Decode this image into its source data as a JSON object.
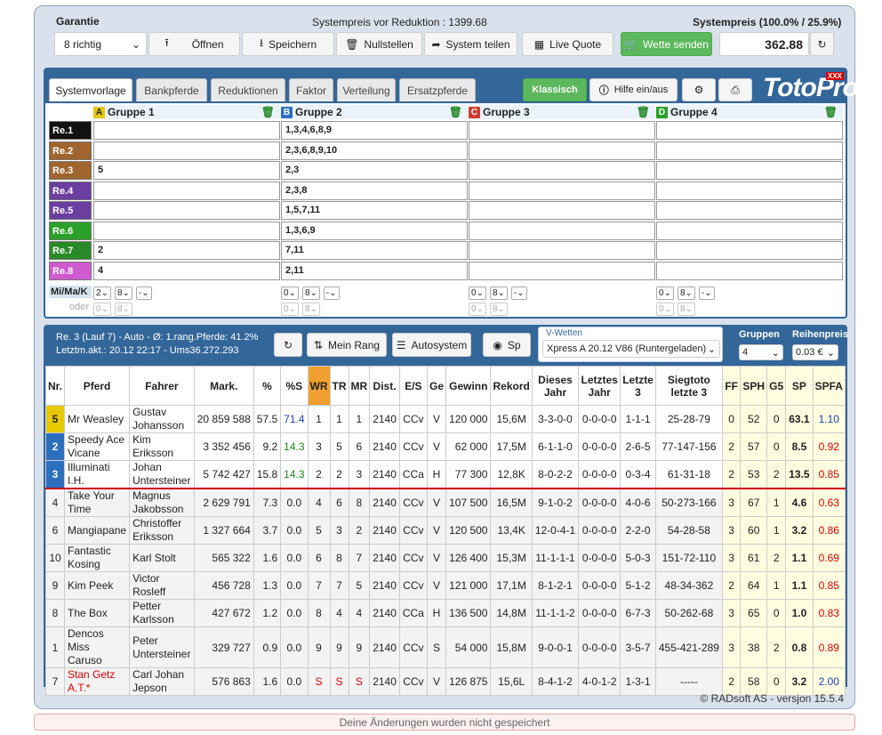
{
  "top": {
    "garantie": "Garantie",
    "richtig": "8 richtig",
    "systempreis_label": "Systempreis vor Reduktion : 1399.68",
    "systempreis_right": "Systempreis (100.0% / 25.9%)",
    "price": "362.88",
    "buttons": {
      "open": "Öffnen",
      "save": "Speichern",
      "reset": "Nullstellen",
      "share": "System teilen",
      "live": "Live Quote",
      "send": "Wette senden"
    }
  },
  "tabs": [
    "Systemvorlage",
    "Bankpferde",
    "Reduktionen",
    "Faktor",
    "Verteilung",
    "Ersatzpferde"
  ],
  "toolbar": {
    "klassisch": "Klassisch",
    "hilfe": "Hilfe ein/aus",
    "logo": "TotoPro",
    "logo_badge": "XXX"
  },
  "groups": [
    {
      "letter": "A",
      "name": "Gruppe 1",
      "color": "#e8c800"
    },
    {
      "letter": "B",
      "name": "Gruppe 2",
      "color": "#2d6fbf"
    },
    {
      "letter": "C",
      "name": "Gruppe 3",
      "color": "#d33b2c"
    },
    {
      "letter": "D",
      "name": "Gruppe 4",
      "color": "#2aa02a"
    }
  ],
  "rows": [
    {
      "label": "Re.1",
      "color": "#111111",
      "g": [
        "",
        "1,3,4,6,8,9",
        "",
        ""
      ]
    },
    {
      "label": "Re.2",
      "color": "#a0642e",
      "g": [
        "",
        "2,3,6,8,9,10",
        "",
        ""
      ]
    },
    {
      "label": "Re.3",
      "color": "#a0642e",
      "g": [
        "5",
        "2,3",
        "",
        ""
      ]
    },
    {
      "label": "Re.4",
      "color": "#6b3fa0",
      "g": [
        "",
        "2,3,8",
        "",
        ""
      ]
    },
    {
      "label": "Re.5",
      "color": "#6b3fa0",
      "g": [
        "",
        "1,5,7,11",
        "",
        ""
      ]
    },
    {
      "label": "Re.6",
      "color": "#2aa02a",
      "g": [
        "",
        "1,3,6,9",
        "",
        ""
      ]
    },
    {
      "label": "Re.7",
      "color": "#2a8a2a",
      "g": [
        "2",
        "7,11",
        "",
        ""
      ]
    },
    {
      "label": "Re.8",
      "color": "#d05ad0",
      "g": [
        "4",
        "2,11",
        "",
        ""
      ]
    }
  ],
  "mimak": {
    "label": "Mi/Ma/K",
    "oder": "oder",
    "v1": "2",
    "v2": "8",
    "v3": "-",
    "z": "0"
  },
  "info": {
    "line1": "Re. 3 (Lauf 7) - Auto - Ø: 1.rang.Pferde: 41.2%",
    "line2": "Letztm.akt.: 20.12 22:17 - Ums36.272.293",
    "mein_rang": "Mein Rang",
    "autosystem": "Autosystem",
    "sp": "Sp",
    "vwetten_label": "V-Wetten",
    "vwetten": "Xpress A 20.12 V86 (Runtergeladen)",
    "gruppen_label": "Gruppen",
    "gruppen": "4",
    "reihenpreis_label": "Reihenpreis",
    "reihenpreis": "0.03 €"
  },
  "columns": [
    "Nr.",
    "Pferd",
    "Fahrer",
    "Mark.",
    "%",
    "%S",
    "WR",
    "TR",
    "MR",
    "Dist.",
    "E/S",
    "Ge",
    "Gewinn",
    "Rekord",
    "Dieses Jahr",
    "Letztes Jahr",
    "Letzte 3",
    "Siegtoto letzte 3",
    "FF",
    "SPH",
    "G5",
    "SP",
    "SPFA"
  ],
  "horses": [
    {
      "nr": "5",
      "pferd": "Mr Weasley",
      "fahrer": "Gustav Johansson",
      "mark": "20 859 588",
      "p": "57.5",
      "ps": "71.4",
      "wr": "1",
      "tr": "1",
      "mr": "1",
      "dist": "2140",
      "es": "CCv",
      "ge": "V",
      "gewinn": "120 000",
      "rekord": "15,6M",
      "dj": "3-3-0-0",
      "lj": "0-0-0-0",
      "l3": "1-1-1",
      "st": "25-28-79",
      "ff": "0",
      "sph": "52",
      "g5": "0",
      "sp": "63.1",
      "spfa": "1.10"
    },
    {
      "nr": "2",
      "pferd": "Speedy Ace Vicane",
      "fahrer": "Kim Eriksson",
      "mark": "3 352 456",
      "p": "9.2",
      "ps": "14.3",
      "wr": "3",
      "tr": "5",
      "mr": "6",
      "dist": "2140",
      "es": "CCv",
      "ge": "V",
      "gewinn": "62 000",
      "rekord": "17,5M",
      "dj": "6-1-1-0",
      "lj": "0-0-0-0",
      "l3": "2-6-5",
      "st": "77-147-156",
      "ff": "2",
      "sph": "57",
      "g5": "0",
      "sp": "8.5",
      "spfa": "0.92"
    },
    {
      "nr": "3",
      "pferd": "Illuminati I.H.",
      "fahrer": "Johan Untersteiner",
      "mark": "5 742 427",
      "p": "15.8",
      "ps": "14.3",
      "wr": "2",
      "tr": "2",
      "mr": "3",
      "dist": "2140",
      "es": "CCa",
      "ge": "H",
      "gewinn": "77 300",
      "rekord": "12,8K",
      "dj": "8-0-2-2",
      "lj": "0-0-0-0",
      "l3": "0-3-4",
      "st": "61-31-18",
      "ff": "2",
      "sph": "53",
      "g5": "2",
      "sp": "13.5",
      "spfa": "0.85"
    },
    {
      "nr": "4",
      "pferd": "Take Your Time",
      "fahrer": "Magnus Jakobsson",
      "mark": "2 629 791",
      "p": "7.3",
      "ps": "0.0",
      "wr": "4",
      "tr": "6",
      "mr": "8",
      "dist": "2140",
      "es": "CCv",
      "ge": "V",
      "gewinn": "107 500",
      "rekord": "16,5M",
      "dj": "9-1-0-2",
      "lj": "0-0-0-0",
      "l3": "4-0-6",
      "st": "50-273-166",
      "ff": "3",
      "sph": "67",
      "g5": "1",
      "sp": "4.6",
      "spfa": "0.63"
    },
    {
      "nr": "6",
      "pferd": "Mangiapane",
      "fahrer": "Christoffer Eriksson",
      "mark": "1 327 664",
      "p": "3.7",
      "ps": "0.0",
      "wr": "5",
      "tr": "3",
      "mr": "2",
      "dist": "2140",
      "es": "CCv",
      "ge": "V",
      "gewinn": "120 500",
      "rekord": "13,4K",
      "dj": "12-0-4-1",
      "lj": "0-0-0-0",
      "l3": "2-2-0",
      "st": "54-28-58",
      "ff": "3",
      "sph": "60",
      "g5": "1",
      "sp": "3.2",
      "spfa": "0.86"
    },
    {
      "nr": "10",
      "pferd": "Fantastic Kosing",
      "fahrer": "Karl Stolt",
      "mark": "565 322",
      "p": "1.6",
      "ps": "0.0",
      "wr": "6",
      "tr": "8",
      "mr": "7",
      "dist": "2140",
      "es": "CCv",
      "ge": "V",
      "gewinn": "126 400",
      "rekord": "15,3M",
      "dj": "11-1-1-1",
      "lj": "0-0-0-0",
      "l3": "5-0-3",
      "st": "151-72-110",
      "ff": "3",
      "sph": "61",
      "g5": "2",
      "sp": "1.1",
      "spfa": "0.69"
    },
    {
      "nr": "9",
      "pferd": "Kim Peek",
      "fahrer": "Victor Rosleff",
      "mark": "456 728",
      "p": "1.3",
      "ps": "0.0",
      "wr": "7",
      "tr": "7",
      "mr": "5",
      "dist": "2140",
      "es": "CCv",
      "ge": "V",
      "gewinn": "121 000",
      "rekord": "17,1M",
      "dj": "8-1-2-1",
      "lj": "0-0-0-0",
      "l3": "5-1-2",
      "st": "48-34-362",
      "ff": "2",
      "sph": "64",
      "g5": "1",
      "sp": "1.1",
      "spfa": "0.85"
    },
    {
      "nr": "8",
      "pferd": "The Box",
      "fahrer": "Petter Karlsson",
      "mark": "427 672",
      "p": "1.2",
      "ps": "0.0",
      "wr": "8",
      "tr": "4",
      "mr": "4",
      "dist": "2140",
      "es": "CCa",
      "ge": "H",
      "gewinn": "136 500",
      "rekord": "14,8M",
      "dj": "11-1-1-2",
      "lj": "0-0-0-0",
      "l3": "6-7-3",
      "st": "50-262-68",
      "ff": "3",
      "sph": "65",
      "g5": "0",
      "sp": "1.0",
      "spfa": "0.83"
    },
    {
      "nr": "1",
      "pferd": "Dencos Miss Caruso",
      "fahrer": "Peter Untersteiner",
      "mark": "329 727",
      "p": "0.9",
      "ps": "0.0",
      "wr": "9",
      "tr": "9",
      "mr": "9",
      "dist": "2140",
      "es": "CCv",
      "ge": "S",
      "gewinn": "54 000",
      "rekord": "15,8M",
      "dj": "9-0-0-1",
      "lj": "0-0-0-0",
      "l3": "3-5-7",
      "st": "455-421-289",
      "ff": "3",
      "sph": "38",
      "g5": "2",
      "sp": "0.8",
      "spfa": "0.89"
    },
    {
      "nr": "7",
      "pferd": "Stan Getz A.T.*",
      "fahrer": "Carl Johan Jepson",
      "mark": "576 863",
      "p": "1.6",
      "ps": "0.0",
      "wr": "S",
      "tr": "S",
      "mr": "S",
      "dist": "2140",
      "es": "CCv",
      "ge": "V",
      "gewinn": "126 875",
      "rekord": "15,6L",
      "dj": "8-4-1-2",
      "lj": "4-0-1-2",
      "l3": "1-3-1",
      "st": "-----",
      "ff": "2",
      "sph": "58",
      "g5": "0",
      "sp": "3.2",
      "spfa": "2.00"
    }
  ],
  "footer": "© RADsoft AS - versjon 15.5.4",
  "warning": "Deine Änderungen wurden nicht gespeichert"
}
